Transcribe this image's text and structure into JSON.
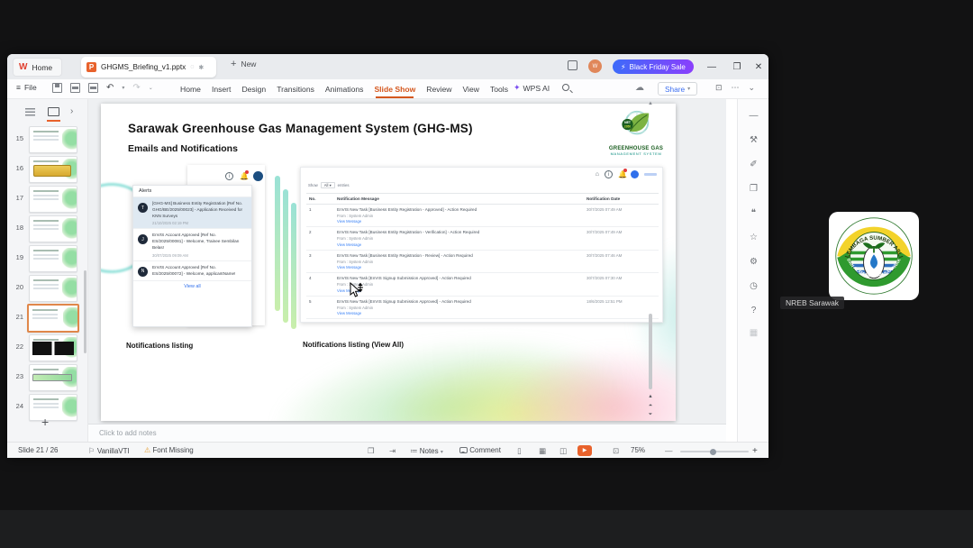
{
  "titlebar": {
    "home_tab_label": "Home",
    "doc_tab_label": "GHGMS_Briefing_v1.pptx",
    "new_label": "New",
    "promo_label": "Black Friday Sale",
    "promo_bolt": "⚡",
    "avatar_initial": "W"
  },
  "menubar": {
    "file_label": "File",
    "items": [
      {
        "label": "Home"
      },
      {
        "label": "Insert"
      },
      {
        "label": "Design"
      },
      {
        "label": "Transitions"
      },
      {
        "label": "Animations"
      },
      {
        "label": "Slide Show",
        "active": true
      },
      {
        "label": "Review"
      },
      {
        "label": "View"
      },
      {
        "label": "Tools"
      }
    ],
    "wps_ai_label": "WPS AI",
    "share_label": "Share"
  },
  "slide_panel": {
    "thumbnails": [
      {
        "number": 15,
        "variant": "green"
      },
      {
        "number": 16,
        "variant": "gold"
      },
      {
        "number": 17,
        "variant": "green"
      },
      {
        "number": 18,
        "variant": "green"
      },
      {
        "number": 19,
        "variant": "green"
      },
      {
        "number": 20,
        "variant": "green"
      },
      {
        "number": 21,
        "variant": "green",
        "selected": true
      },
      {
        "number": 22,
        "variant": "dark"
      },
      {
        "number": 23,
        "variant": "greenbar"
      },
      {
        "number": 24,
        "variant": "green"
      }
    ]
  },
  "slide": {
    "title": "Sarawak Greenhouse Gas Management System (GHG-MS)",
    "subtitle": "Emails and Notifications",
    "logo": {
      "badge_top": "NET",
      "badge_bottom": "2050",
      "line1": "GREENHOUSE GAS",
      "line2": "MANAGEMENT SYSTEM"
    },
    "captions": {
      "left": "Notifications listing",
      "right": "Notifications listing (View All)"
    },
    "alerts": {
      "title": "Alerts",
      "items": [
        {
          "initial": "T",
          "text": "[GHG-MS] Business Entity Registration [Ref No. GHG/BE/2025/00023] - Application Received for KNN Surveys",
          "date": "21/10/2025 02:19 PM",
          "highlighted": true
        },
        {
          "initial": "J",
          "text": "EnVIS Account Approved [Ref No. ES/2025/00081] - Welcome, Trainee Sembilan Belas!",
          "date": "30/07/2025 09:09 AM",
          "highlighted": false
        },
        {
          "initial": "N",
          "text": "EnVIS Account Approved [Ref No. ES/2025/00072] - Welcome, applicantName!",
          "date": "",
          "highlighted": false
        }
      ],
      "view_all": "View all"
    },
    "listing": {
      "show_label": "Show",
      "show_value": "All",
      "entries_label": "entries",
      "headers": {
        "no": "No.",
        "message": "Notification Message",
        "date": "Notification Date"
      },
      "rows": [
        {
          "no": "1",
          "message": "EnVIS New Task [Business Entity Registration - Approved] - Action Required",
          "from": "From : System Admin",
          "link": "View Message",
          "date": "30/7/2025 07:49 AM"
        },
        {
          "no": "2",
          "message": "EnVIS New Task [Business Entity Registration - Verification] - Action Required",
          "from": "From : System Admin",
          "link": "View Message",
          "date": "30/7/2025 07:49 AM"
        },
        {
          "no": "3",
          "message": "EnVIS New Task [Business Entity Registration - Review] - Action Required",
          "from": "From : System Admin",
          "link": "View Message",
          "date": "30/7/2025 07:46 AM"
        },
        {
          "no": "4",
          "message": "EnVIS New Task [EnVIS Signup Submission Approved] - Action Required",
          "from": "From : System Admin",
          "link": "View Message",
          "date": "30/7/2025 07:30 AM"
        },
        {
          "no": "5",
          "message": "EnVIS New Task [EnVIS Signup Submission Approved] - Action Required",
          "from": "From : System Admin",
          "link": "View Message",
          "date": "18/6/2025 12:51 PM"
        }
      ]
    }
  },
  "notes": {
    "placeholder": "Click to add notes"
  },
  "statusbar": {
    "slide_info": "Slide 21 / 26",
    "theme_name": "VanillaVTI",
    "font_warning": "Font Missing",
    "notes_label": "Notes",
    "comment_label": "Comment",
    "zoom_value": "75%"
  },
  "side_toolbar": {
    "icons": [
      {
        "name": "collapse-icon",
        "glyph": "—"
      },
      {
        "name": "tools-icon",
        "glyph": "⚒"
      },
      {
        "name": "smart-edit-icon",
        "glyph": "✐"
      },
      {
        "name": "shapes-icon",
        "glyph": "❐"
      },
      {
        "name": "comment-icon",
        "glyph": "❝"
      },
      {
        "name": "star-icon",
        "glyph": "☆"
      },
      {
        "name": "settings-icon",
        "glyph": "⚙"
      },
      {
        "name": "history-icon",
        "glyph": "◷"
      },
      {
        "name": "help-icon",
        "glyph": "?"
      },
      {
        "name": "apps-icon",
        "glyph": "▦"
      }
    ]
  },
  "participant": {
    "name": "NREB Sarawak",
    "logo_top_text": "LEMBAGA SUMBER ASLI",
    "logo_bottom_text": "DAN ALAM SEKITAR SARAWAK"
  },
  "colors": {
    "accent_orange": "#d4571e",
    "play_button": "#e8622c",
    "promo_start": "#3d6bfa",
    "promo_end": "#8a3ffc",
    "link_blue": "#3b82f6"
  }
}
